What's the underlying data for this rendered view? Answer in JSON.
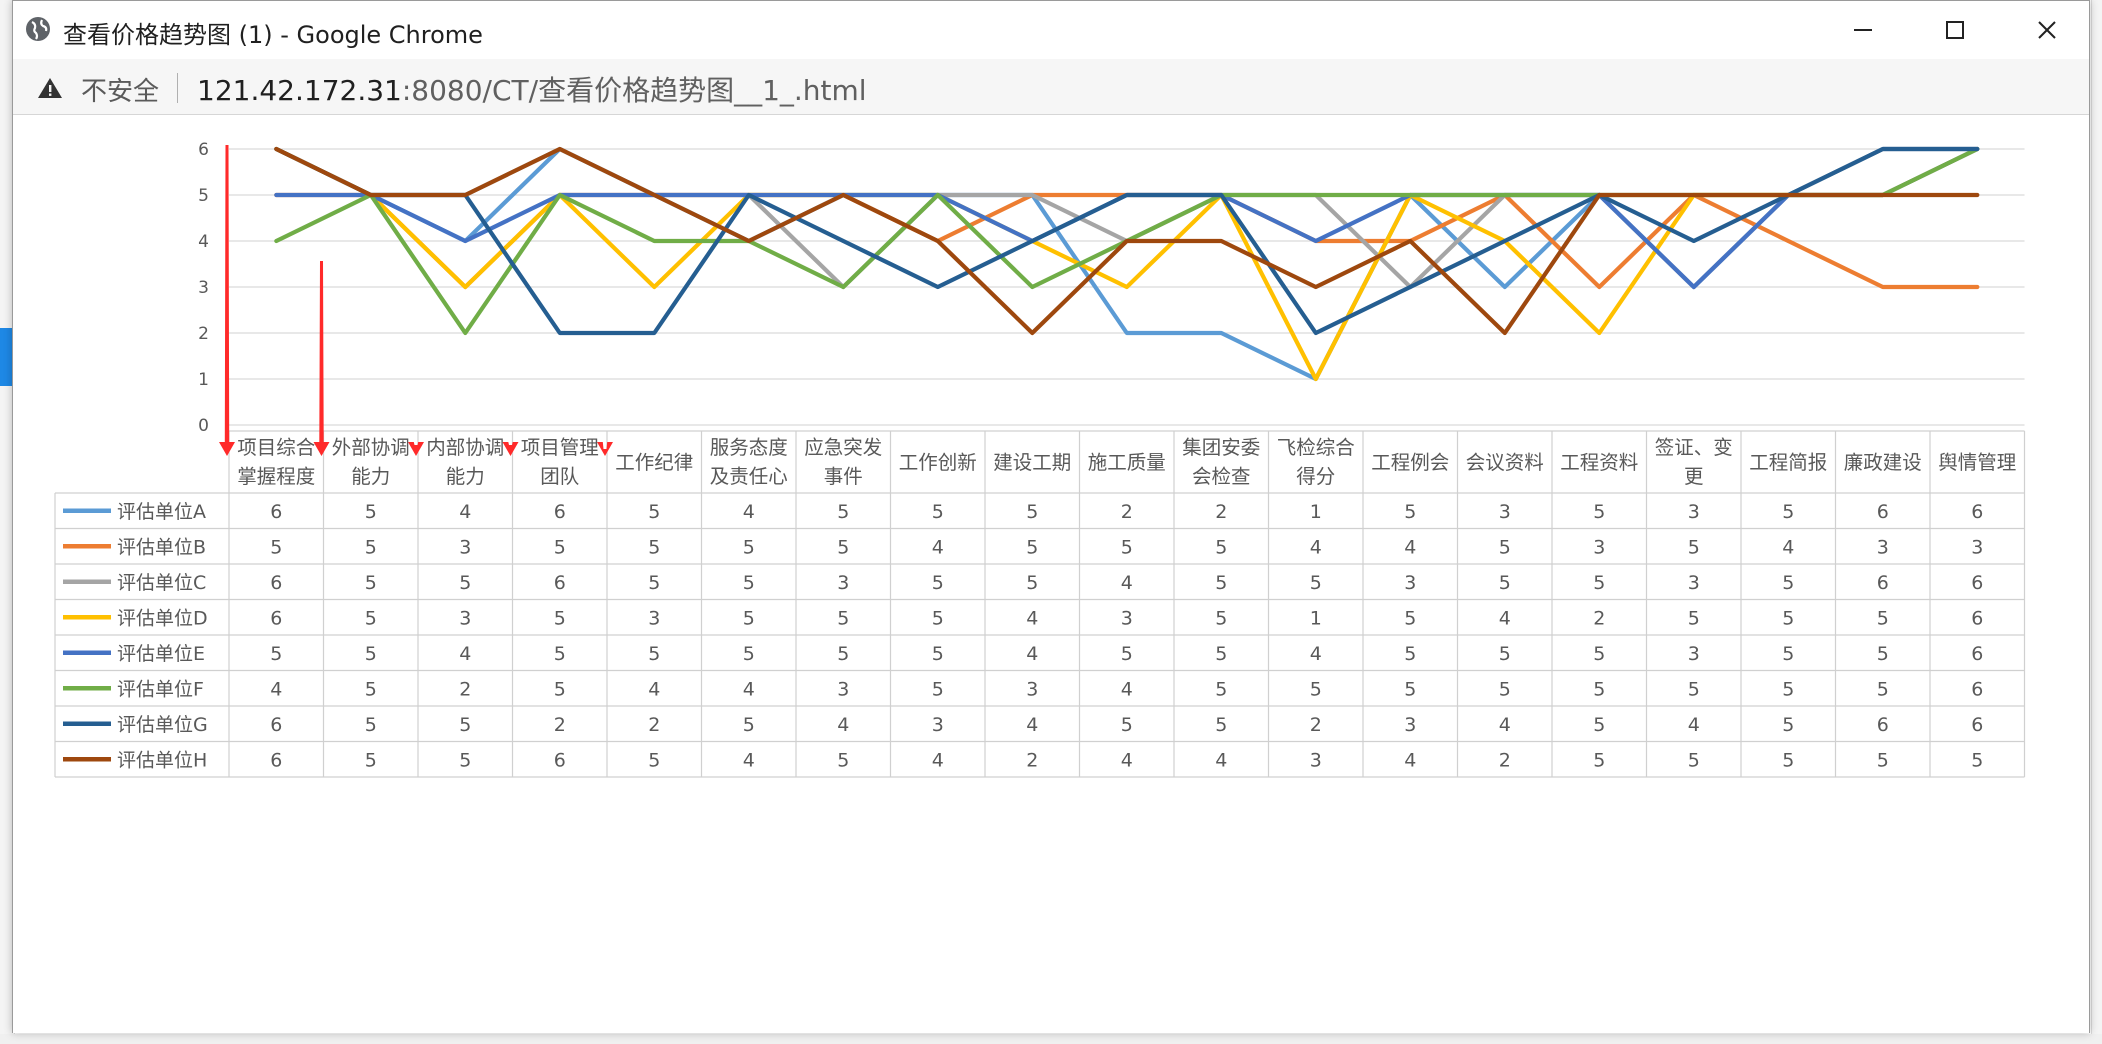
{
  "window": {
    "title": "查看价格趋势图 (1) - Google Chrome",
    "icon": "globe-icon",
    "controls": [
      "minimize-icon",
      "maximize-icon",
      "close-icon"
    ]
  },
  "address_bar": {
    "security_label": "不安全",
    "url_host": "121.42.172.31",
    "url_rest": ":8080/CT/查看价格趋势图__1_.html",
    "icon": "warning-icon"
  },
  "colors": {
    "accent_arrows": "#ff2a2a",
    "grid": "#d9d9d9",
    "table_border": "#d0d0d0"
  },
  "chart_data": {
    "type": "line",
    "ylim": [
      0,
      7
    ],
    "yticks": [
      0,
      1,
      2,
      3,
      4,
      5,
      6,
      7
    ],
    "grid": true,
    "legend": "left-table",
    "categories": [
      [
        "项目综合",
        "掌握程度"
      ],
      [
        "外部协调",
        "能力"
      ],
      [
        "内部协调",
        "能力"
      ],
      [
        "项目管理",
        "团队"
      ],
      [
        "工作纪律"
      ],
      [
        "服务态度",
        "及责任心"
      ],
      [
        "应急突发",
        "事件"
      ],
      [
        "工作创新"
      ],
      [
        "建设工期"
      ],
      [
        "施工质量"
      ],
      [
        "集团安委",
        "会检查"
      ],
      [
        "飞检综合",
        "得分"
      ],
      [
        "工程例会"
      ],
      [
        "会议资料"
      ],
      [
        "工程资料"
      ],
      [
        "签证、变",
        "更"
      ],
      [
        "工程简报"
      ],
      [
        "廉政建设"
      ],
      [
        "舆情管理"
      ]
    ],
    "series": [
      {
        "name": "评估单位A",
        "color": "#5b9bd5",
        "values": [
          6,
          5,
          4,
          6,
          5,
          4,
          5,
          5,
          5,
          2,
          2,
          1,
          5,
          3,
          5,
          3,
          5,
          6,
          6
        ]
      },
      {
        "name": "评估单位B",
        "color": "#ed7d31",
        "values": [
          5,
          5,
          3,
          5,
          5,
          5,
          5,
          4,
          5,
          5,
          5,
          4,
          4,
          5,
          3,
          5,
          4,
          3,
          3
        ]
      },
      {
        "name": "评估单位C",
        "color": "#a5a5a5",
        "values": [
          6,
          5,
          5,
          6,
          5,
          5,
          3,
          5,
          5,
          4,
          5,
          5,
          3,
          5,
          5,
          3,
          5,
          6,
          6
        ]
      },
      {
        "name": "评估单位D",
        "color": "#ffc000",
        "values": [
          6,
          5,
          3,
          5,
          3,
          5,
          5,
          5,
          4,
          3,
          5,
          1,
          5,
          4,
          2,
          5,
          5,
          5,
          6
        ]
      },
      {
        "name": "评估单位E",
        "color": "#4472c4",
        "values": [
          5,
          5,
          4,
          5,
          5,
          5,
          5,
          5,
          4,
          5,
          5,
          4,
          5,
          5,
          5,
          3,
          5,
          5,
          6
        ]
      },
      {
        "name": "评估单位F",
        "color": "#70ad47",
        "values": [
          4,
          5,
          2,
          5,
          4,
          4,
          3,
          5,
          3,
          4,
          5,
          5,
          5,
          5,
          5,
          5,
          5,
          5,
          6
        ]
      },
      {
        "name": "评估单位G",
        "color": "#255e91",
        "values": [
          6,
          5,
          5,
          2,
          2,
          5,
          4,
          3,
          4,
          5,
          5,
          2,
          3,
          4,
          5,
          4,
          5,
          6,
          6
        ]
      },
      {
        "name": "评估单位H",
        "color": "#9e480e",
        "values": [
          6,
          5,
          5,
          6,
          5,
          4,
          5,
          4,
          2,
          4,
          4,
          3,
          4,
          2,
          5,
          5,
          5,
          5,
          5
        ]
      }
    ],
    "annotations": {
      "arrow_categories": [
        0,
        1,
        2,
        3,
        4
      ]
    }
  }
}
